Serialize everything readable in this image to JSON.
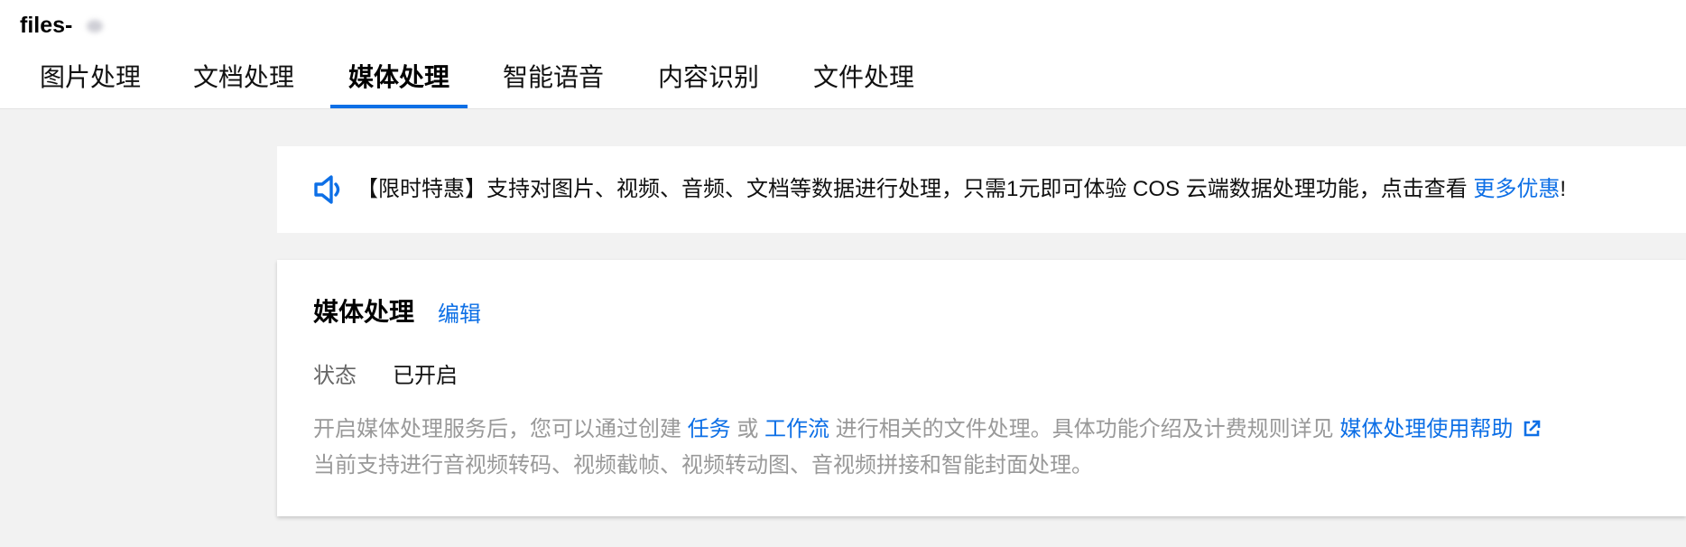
{
  "header": {
    "bucket_name": "files-"
  },
  "tabs": [
    {
      "label": "图片处理"
    },
    {
      "label": "文档处理"
    },
    {
      "label": "媒体处理",
      "active": true
    },
    {
      "label": "智能语音"
    },
    {
      "label": "内容识别"
    },
    {
      "label": "文件处理"
    }
  ],
  "notice": {
    "icon": "speaker-icon",
    "text": "【限时特惠】支持对图片、视频、音频、文档等数据进行处理，只需1元即可体验 COS 云端数据处理功能，点击查看 ",
    "link": "更多优惠",
    "suffix": "!"
  },
  "card": {
    "title": "媒体处理",
    "edit_link": "编辑",
    "status_label": "状态",
    "status_value": "已开启",
    "desc_part1": "开启媒体处理服务后，您可以通过创建 ",
    "desc_link_task": "任务",
    "desc_or": " 或 ",
    "desc_link_workflow": "工作流",
    "desc_part2": " 进行相关的文件处理。具体功能介绍及计费规则详见 ",
    "desc_link_help": "媒体处理使用帮助",
    "desc_line2": "当前支持进行音视频转码、视频截帧、视频转动图、音视频拼接和智能封面处理。"
  },
  "colors": {
    "accent": "#0d6fe6",
    "background": "#f2f2f2",
    "muted": "#999999"
  }
}
